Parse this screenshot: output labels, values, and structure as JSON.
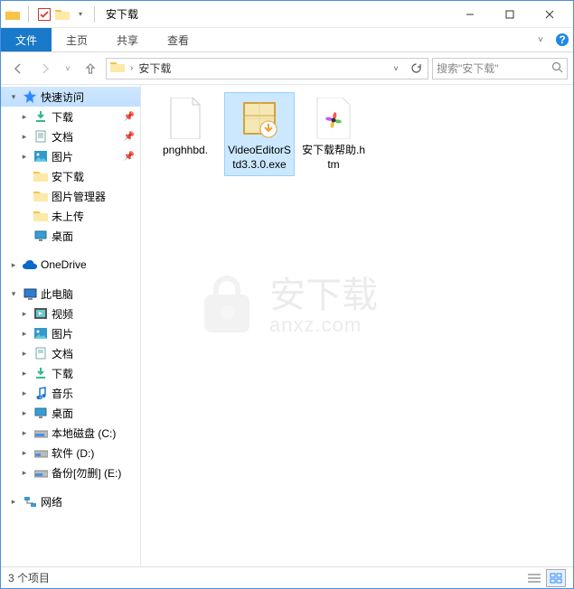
{
  "window": {
    "title": "安下载",
    "controls": {
      "min": "minimize",
      "max": "maximize",
      "close": "close"
    }
  },
  "ribbon": {
    "tabs": {
      "file": "文件",
      "home": "主页",
      "share": "共享",
      "view": "查看"
    },
    "help": "?"
  },
  "address": {
    "crumb": "安下载",
    "refresh": "↻"
  },
  "search": {
    "placeholder": "搜索\"安下载\""
  },
  "nav": {
    "quick": "快速访问",
    "downloads": "下载",
    "documents": "文档",
    "pictures": "图片",
    "anxz": "安下载",
    "picmgr": "图片管理器",
    "notuploaded": "未上传",
    "desktop1": "桌面",
    "onedrive": "OneDrive",
    "thispc": "此电脑",
    "videos": "视频",
    "pictures2": "图片",
    "documents2": "文档",
    "downloads2": "下载",
    "music": "音乐",
    "desktop2": "桌面",
    "diskC": "本地磁盘 (C:)",
    "diskD": "软件 (D:)",
    "diskE": "备份[勿删] (E:)",
    "network": "网络"
  },
  "files": [
    {
      "name": "pnghhbd.",
      "selected": false,
      "icon": "blank"
    },
    {
      "name": "VideoEditorStd3.3.0.exe",
      "selected": true,
      "icon": "installer"
    },
    {
      "name": "安下载帮助.htm",
      "selected": false,
      "icon": "pinwheel"
    }
  ],
  "status": {
    "count": "3 个项目"
  },
  "watermark": {
    "big": "安下载",
    "small": "anxz.com"
  }
}
